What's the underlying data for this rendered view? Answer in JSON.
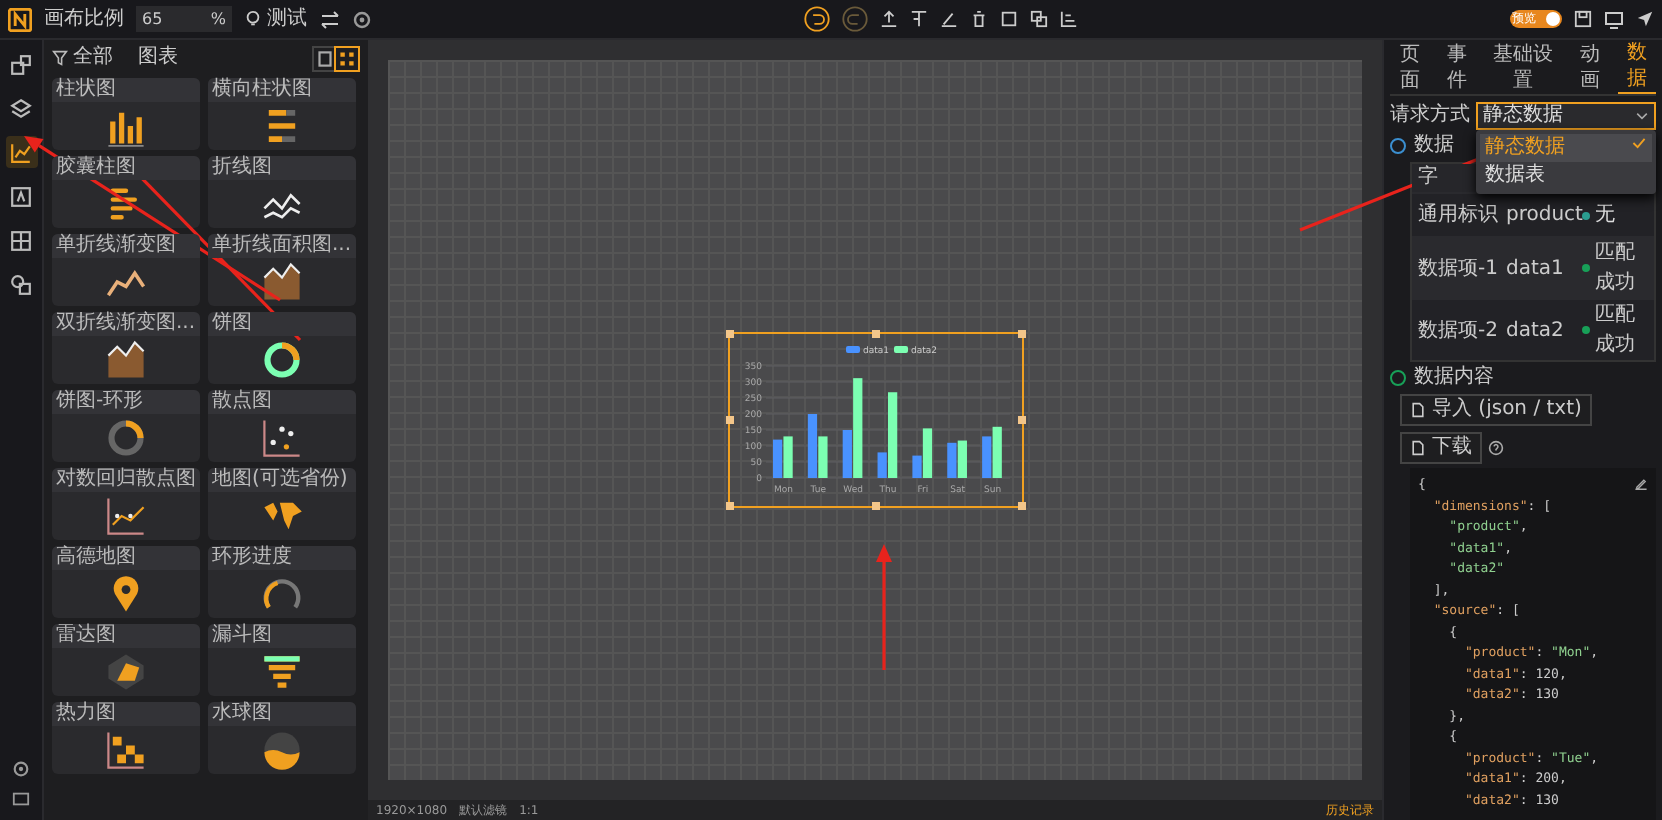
{
  "toolbar": {
    "scale_label": "画布比例",
    "scale_value": "65",
    "scale_unit": "%",
    "test_label": "测试",
    "preview_toggle": {
      "label": "预览",
      "on": true
    }
  },
  "icon_sidebar": [
    {
      "kind": "components",
      "selected": false
    },
    {
      "kind": "layers",
      "selected": false
    },
    {
      "kind": "chart",
      "selected": true
    },
    {
      "kind": "text",
      "selected": false
    },
    {
      "kind": "table",
      "selected": false
    },
    {
      "kind": "shapes",
      "selected": false
    }
  ],
  "chart_panel": {
    "filter": "全部",
    "title": "图表",
    "view_modes": [
      {
        "kind": "single",
        "selected": false
      },
      {
        "kind": "grid",
        "selected": true
      }
    ],
    "items": [
      {
        "label": "柱状图",
        "kind": "bar"
      },
      {
        "label": "横向柱状图",
        "kind": "hbar"
      },
      {
        "label": "胶囊柱图",
        "kind": "capsule"
      },
      {
        "label": "折线图",
        "kind": "line"
      },
      {
        "label": "单折线渐变图",
        "kind": "line2"
      },
      {
        "label": "单折线面积图...",
        "kind": "area"
      },
      {
        "label": "双折线渐变图...",
        "kind": "area"
      },
      {
        "label": "饼图",
        "kind": "ring"
      },
      {
        "label": "饼图-环形",
        "kind": "ring2"
      },
      {
        "label": "散点图",
        "kind": "scatter"
      },
      {
        "label": "对数回归散点图",
        "kind": "scatter2"
      },
      {
        "label": "地图(可选省份)",
        "kind": "map"
      },
      {
        "label": "高德地图",
        "kind": "pin"
      },
      {
        "label": "环形进度",
        "kind": "gauge"
      },
      {
        "label": "雷达图",
        "kind": "radar"
      },
      {
        "label": "漏斗图",
        "kind": "funnel"
      },
      {
        "label": "热力图",
        "kind": "heat"
      },
      {
        "label": "水球图",
        "kind": "water"
      }
    ]
  },
  "canvas": {
    "chart": {
      "selected": true,
      "chart_data": {
        "type": "bar",
        "categories": [
          "Mon",
          "Tue",
          "Wed",
          "Thu",
          "Fri",
          "Sat",
          "Sun"
        ],
        "series": [
          {
            "name": "data1",
            "color": "#4992ff",
            "values": [
              120,
              200,
              150,
              80,
              70,
              110,
              130
            ]
          },
          {
            "name": "data2",
            "color": "#7cffb2",
            "values": [
              130,
              130,
              312,
              268,
              155,
              117,
              160
            ]
          }
        ],
        "grid": true,
        "legend": true,
        "ylim": [
          0,
          350
        ],
        "yticks": [
          0,
          50,
          100,
          150,
          200,
          250,
          300,
          350
        ]
      }
    }
  },
  "status_bar": {
    "size": "1920×1080",
    "filter": "默认滤镜",
    "ratio": "1:1",
    "history": "历史记录"
  },
  "settings_panel": {
    "tabs": [
      {
        "label": "页面",
        "selected": false
      },
      {
        "label": "事件",
        "selected": false
      },
      {
        "label": "基础设置",
        "selected": false
      },
      {
        "label": "动画",
        "selected": false
      },
      {
        "label": "数据",
        "selected": true
      }
    ],
    "request_label": "请求方式",
    "request_value": "静态数据",
    "dropdown": [
      {
        "label": "静态数据",
        "selected": true
      },
      {
        "label": "数据表",
        "selected": false
      }
    ],
    "mapping_title": "数据",
    "mapping_header": "字",
    "mapping_rows": [
      {
        "field": "通用标识",
        "key": "product",
        "status": "无",
        "matched": false
      },
      {
        "field": "数据项-1",
        "key": "data1",
        "status": "匹配成功",
        "matched": true
      },
      {
        "field": "数据项-2",
        "key": "data2",
        "status": "匹配成功",
        "matched": true
      }
    ],
    "content_title": "数据内容",
    "import_button": "导入 (json / txt)",
    "download_button": "下载",
    "code_lines": [
      "{",
      "  \"dimensions\": [",
      "    \"product\",",
      "    \"data1\",",
      "    \"data2\"",
      "  ],",
      "  \"source\": [",
      "    {",
      "      \"product\": \"Mon\",",
      "      \"data1\": 120,",
      "      \"data2\": 130",
      "    },",
      "    {",
      "      \"product\": \"Tue\",",
      "      \"data1\": 200,",
      "      \"data2\": 130"
    ]
  }
}
